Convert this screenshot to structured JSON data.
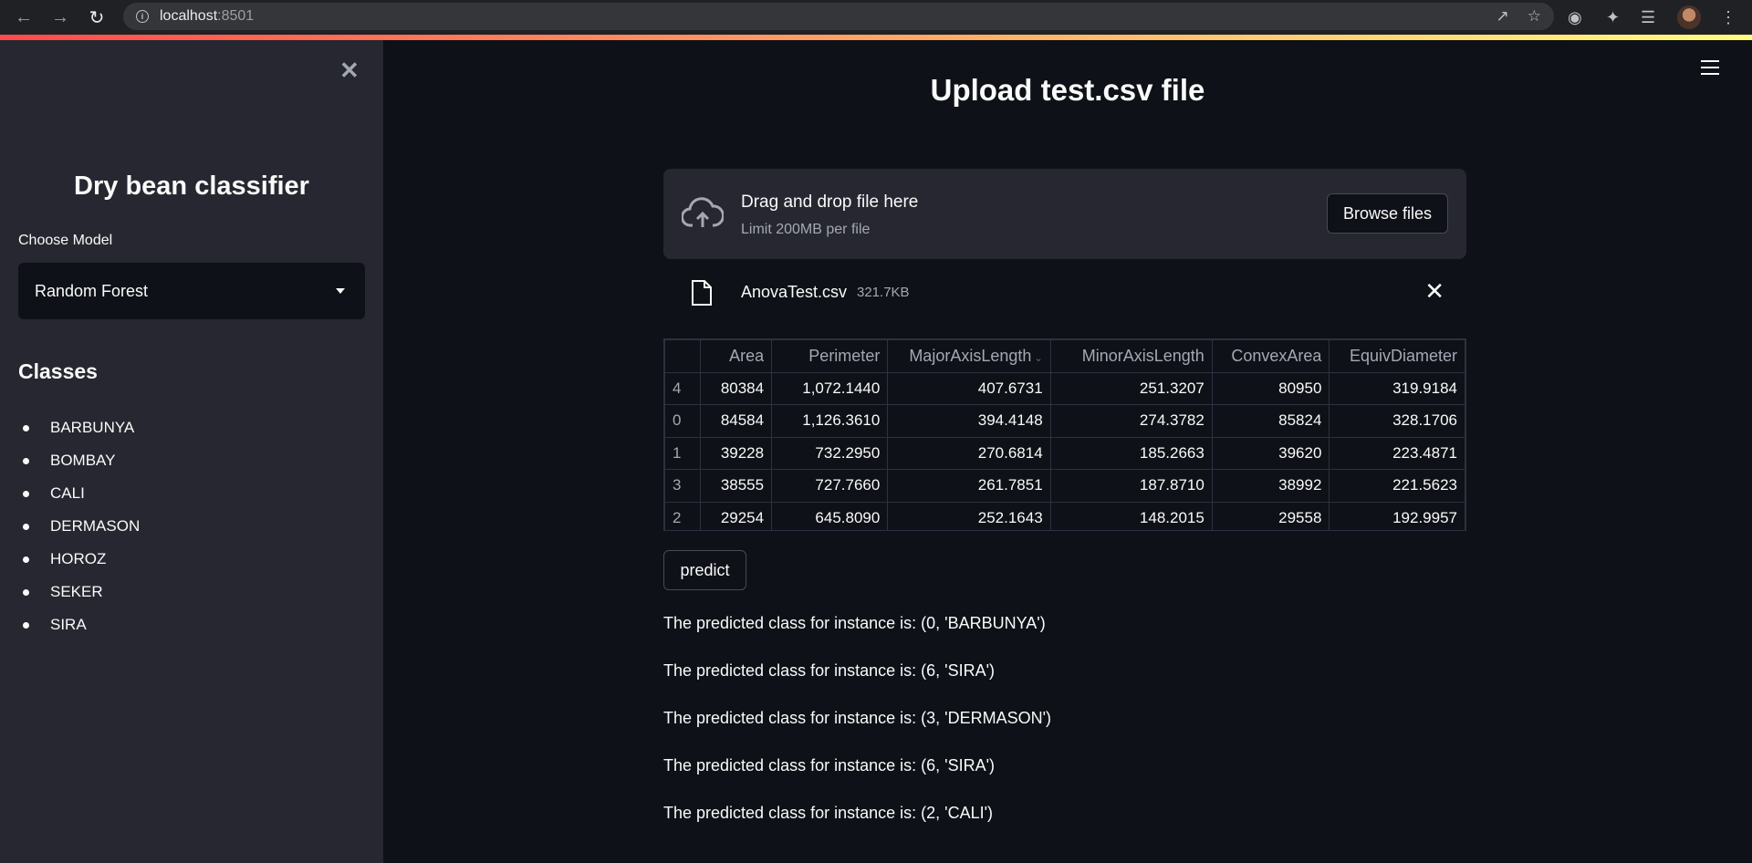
{
  "browser": {
    "url_host": "localhost",
    "url_port": ":8501"
  },
  "sidebar": {
    "title": "Dry bean classifier",
    "choose_label": "Choose Model",
    "selected_model": "Random Forest",
    "classes_title": "Classes",
    "classes": [
      "BARBUNYA",
      "BOMBAY",
      "CALI",
      "DERMASON",
      "HOROZ",
      "SEKER",
      "SIRA"
    ]
  },
  "main": {
    "title": "Upload test.csv file",
    "uploader": {
      "drag_text": "Drag and drop file here",
      "limit_text": "Limit 200MB per file",
      "browse_label": "Browse files"
    },
    "file": {
      "name": "AnovaTest.csv",
      "size": "321.7KB"
    },
    "table": {
      "columns": [
        "",
        "Area",
        "Perimeter",
        "MajorAxisLength",
        "MinorAxisLength",
        "ConvexArea",
        "EquivDiameter"
      ],
      "rows": [
        [
          "4",
          "80384",
          "1,072.1440",
          "407.6731",
          "251.3207",
          "80950",
          "319.9184"
        ],
        [
          "0",
          "84584",
          "1,126.3610",
          "394.4148",
          "274.3782",
          "85824",
          "328.1706"
        ],
        [
          "1",
          "39228",
          "732.2950",
          "270.6814",
          "185.2663",
          "39620",
          "223.4871"
        ],
        [
          "3",
          "38555",
          "727.7660",
          "261.7851",
          "187.8710",
          "38992",
          "221.5623"
        ],
        [
          "2",
          "29254",
          "645.8090",
          "252.1643",
          "148.2015",
          "29558",
          "192.9957"
        ]
      ]
    },
    "predict_label": "predict",
    "predictions": [
      "The predicted class for instance is: (0, 'BARBUNYA')",
      "The predicted class for instance is: (6, 'SIRA')",
      "The predicted class for instance is: (3, 'DERMASON')",
      "The predicted class for instance is: (6, 'SIRA')",
      "The predicted class for instance is: (2, 'CALI')"
    ]
  },
  "colors": {
    "background": "#0e1117",
    "sidebar": "#262730",
    "accent_gradient_start": "#ff4b4b",
    "accent_gradient_end": "#fffd80"
  }
}
